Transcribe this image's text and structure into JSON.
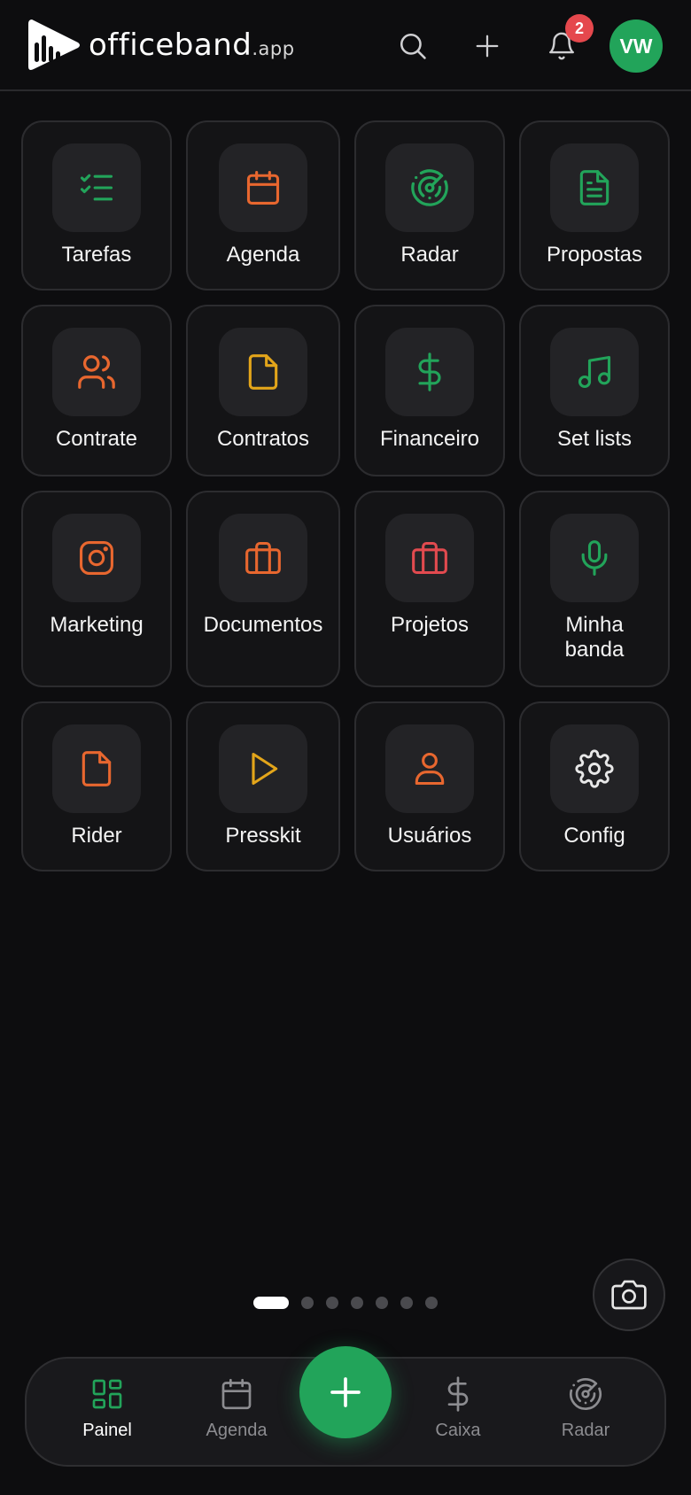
{
  "header": {
    "brand": "officeband",
    "brand_suffix": ".app",
    "notification_count": "2",
    "avatar_initials": "VW"
  },
  "colors": {
    "green": "#22a45a",
    "orange": "#e8672f",
    "yellow": "#e3a51a",
    "red": "#e24a4f",
    "badge": "#e5484d"
  },
  "tiles": [
    {
      "label": "Tarefas",
      "icon": "checklist-icon"
    },
    {
      "label": "Agenda",
      "icon": "calendar-icon"
    },
    {
      "label": "Radar",
      "icon": "radar-icon"
    },
    {
      "label": "Propostas",
      "icon": "document-icon"
    },
    {
      "label": "Contrate",
      "icon": "users-icon"
    },
    {
      "label": "Contratos",
      "icon": "file-icon"
    },
    {
      "label": "Financeiro",
      "icon": "dollar-icon"
    },
    {
      "label": "Set lists",
      "icon": "music-note-icon"
    },
    {
      "label": "Marketing",
      "icon": "instagram-icon"
    },
    {
      "label": "Documentos",
      "icon": "briefcase-icon"
    },
    {
      "label": "Projetos",
      "icon": "briefcase-icon"
    },
    {
      "label": "Minha banda",
      "icon": "microphone-icon"
    },
    {
      "label": "Rider",
      "icon": "file-icon"
    },
    {
      "label": "Presskit",
      "icon": "play-icon"
    },
    {
      "label": "Usuários",
      "icon": "user-icon"
    },
    {
      "label": "Config",
      "icon": "gear-icon"
    }
  ],
  "pager": {
    "pages": 7,
    "active": 1
  },
  "bottom_nav": [
    {
      "label": "Painel",
      "icon": "dashboard-icon",
      "active": true
    },
    {
      "label": "Agenda",
      "icon": "calendar-icon",
      "active": false
    },
    {
      "label": "Caixa",
      "icon": "dollar-icon",
      "active": false
    },
    {
      "label": "Radar",
      "icon": "radar-icon",
      "active": false
    }
  ]
}
